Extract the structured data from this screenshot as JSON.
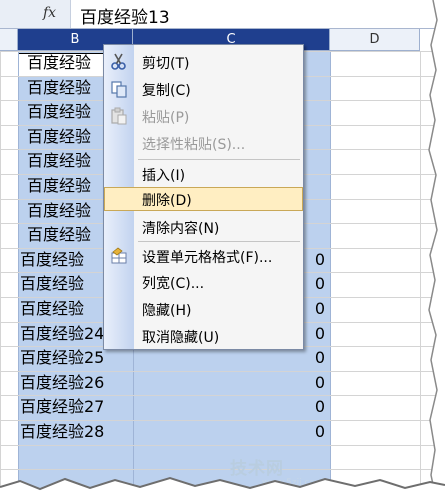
{
  "formula_bar": {
    "fx": "fx",
    "content": "百度经验13"
  },
  "columns": [
    {
      "label": "B",
      "selected": true
    },
    {
      "label": "C",
      "selected": true
    },
    {
      "label": "D",
      "selected": false
    }
  ],
  "rows": [
    {
      "b": "百度经验",
      "c": ""
    },
    {
      "b": "百度经验",
      "c": ""
    },
    {
      "b": "百度经验",
      "c": ""
    },
    {
      "b": "百度经验",
      "c": ""
    },
    {
      "b": "百度经验",
      "c": ""
    },
    {
      "b": "百度经验",
      "c": ""
    },
    {
      "b": "百度经验",
      "c": ""
    },
    {
      "b": "百度经验",
      "c": ""
    },
    {
      "b": "百度经验",
      "c": "0"
    },
    {
      "b": "百度经验",
      "c": "0"
    },
    {
      "b": "百度经验",
      "c": "0"
    },
    {
      "b": "百度经验24",
      "c": "0"
    },
    {
      "b": "百度经验25",
      "c": "0"
    },
    {
      "b": "百度经验26",
      "c": "0"
    },
    {
      "b": "百度经验27",
      "c": "0"
    },
    {
      "b": "百度经验28",
      "c": "0"
    }
  ],
  "context_menu": {
    "items": [
      {
        "label": "剪切(T)",
        "icon": "scissors-icon",
        "enabled": true
      },
      {
        "label": "复制(C)",
        "icon": "copy-icon",
        "enabled": true
      },
      {
        "label": "粘贴(P)",
        "icon": "paste-icon",
        "enabled": false
      },
      {
        "label": "选择性粘贴(S)...",
        "icon": "",
        "enabled": false
      },
      {
        "label": "插入(I)",
        "icon": "",
        "enabled": true
      },
      {
        "label": "删除(D)",
        "icon": "",
        "enabled": true,
        "highlighted": true
      },
      {
        "label": "清除内容(N)",
        "icon": "",
        "enabled": true
      },
      {
        "label": "设置单元格格式(F)...",
        "icon": "format-cells-icon",
        "enabled": true
      },
      {
        "label": "列宽(C)...",
        "icon": "",
        "enabled": true
      },
      {
        "label": "隐藏(H)",
        "icon": "",
        "enabled": true
      },
      {
        "label": "取消隐藏(U)",
        "icon": "",
        "enabled": true
      }
    ]
  },
  "watermark": {
    "text": "技术网",
    "url": "www.5zjj.com"
  }
}
